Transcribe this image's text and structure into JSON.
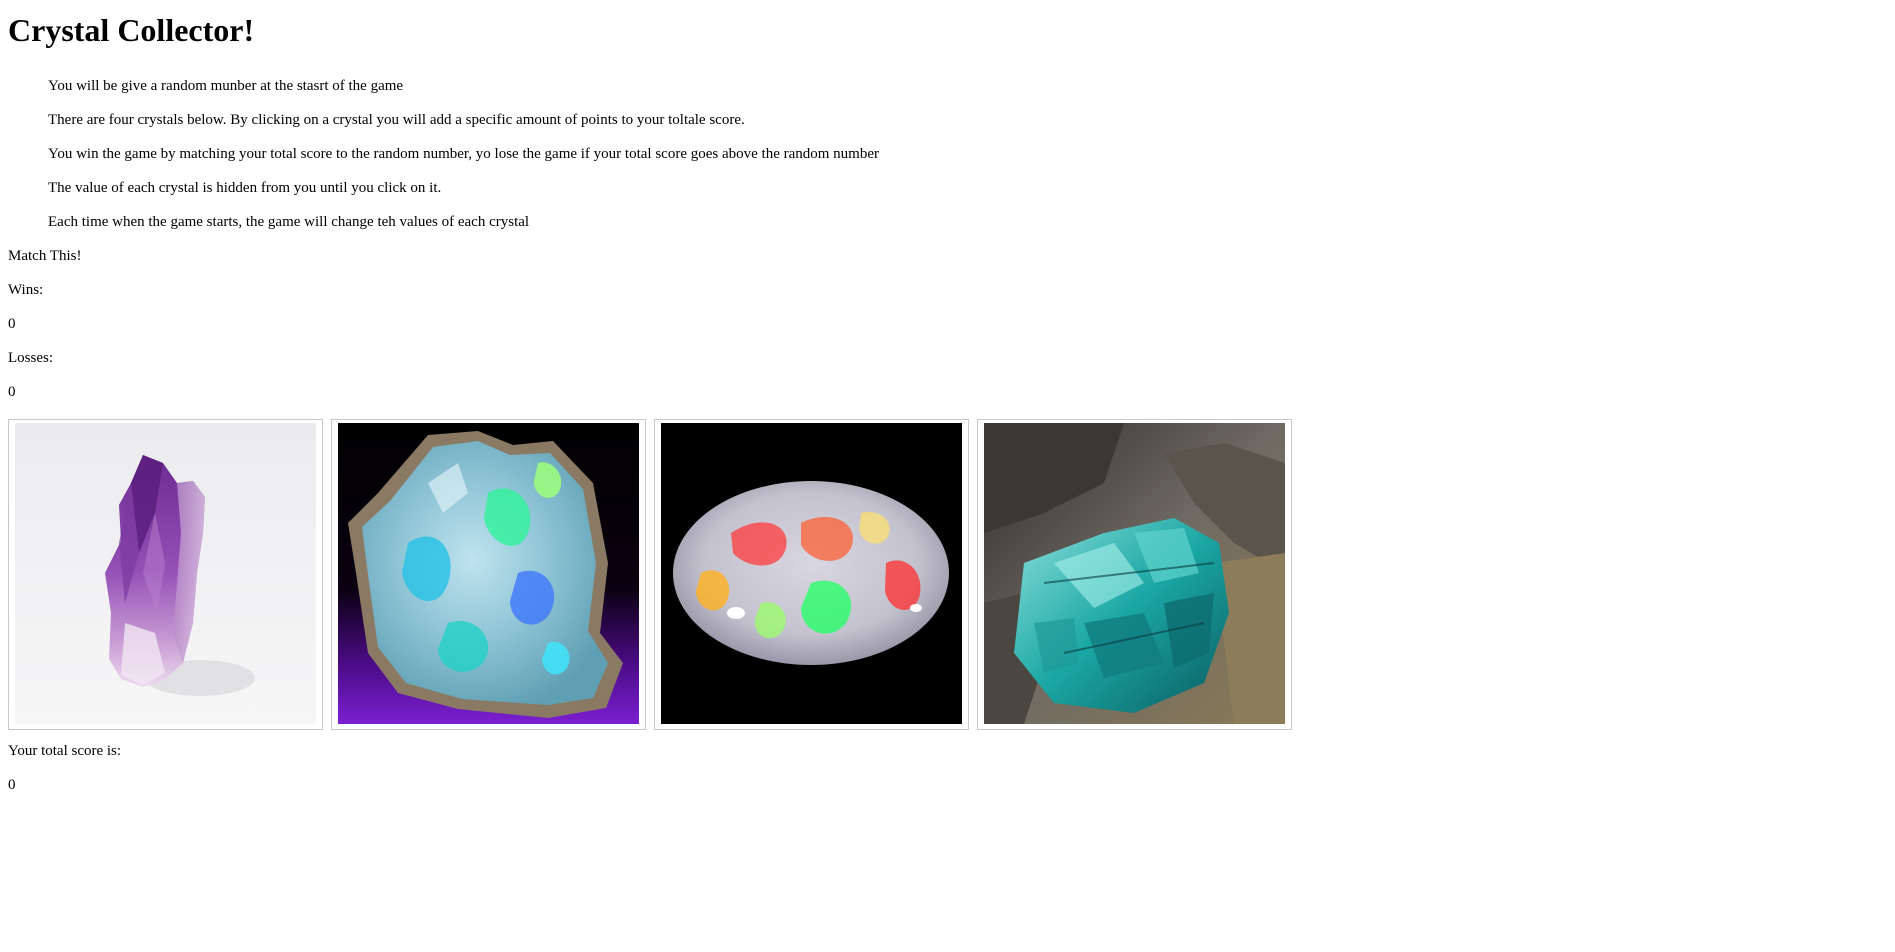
{
  "title": "Crystal Collector!",
  "rules": [
    "You will be give a random munber at the stasrt of the game",
    "There are four crystals below. By clicking on a crystal you will add a specific amount of points to your toltale score.",
    "You win the game by matching your total score to the random number, yo lose the game if your total score goes above the random number",
    "The value of each crystal is hidden from you until you click on it.",
    "Each time when the game starts, the game will change teh values of each crystal"
  ],
  "match_label": "Match This!",
  "wins_label": "Wins:",
  "wins_value": "0",
  "losses_label": "Losses:",
  "losses_value": "0",
  "crystals": [
    {
      "icon": "amethyst-crystal-image"
    },
    {
      "icon": "blue-opal-crystal-image"
    },
    {
      "icon": "fire-opal-crystal-image"
    },
    {
      "icon": "teal-crystal-image"
    }
  ],
  "score_label": "Your total score is:",
  "score_value": "0"
}
